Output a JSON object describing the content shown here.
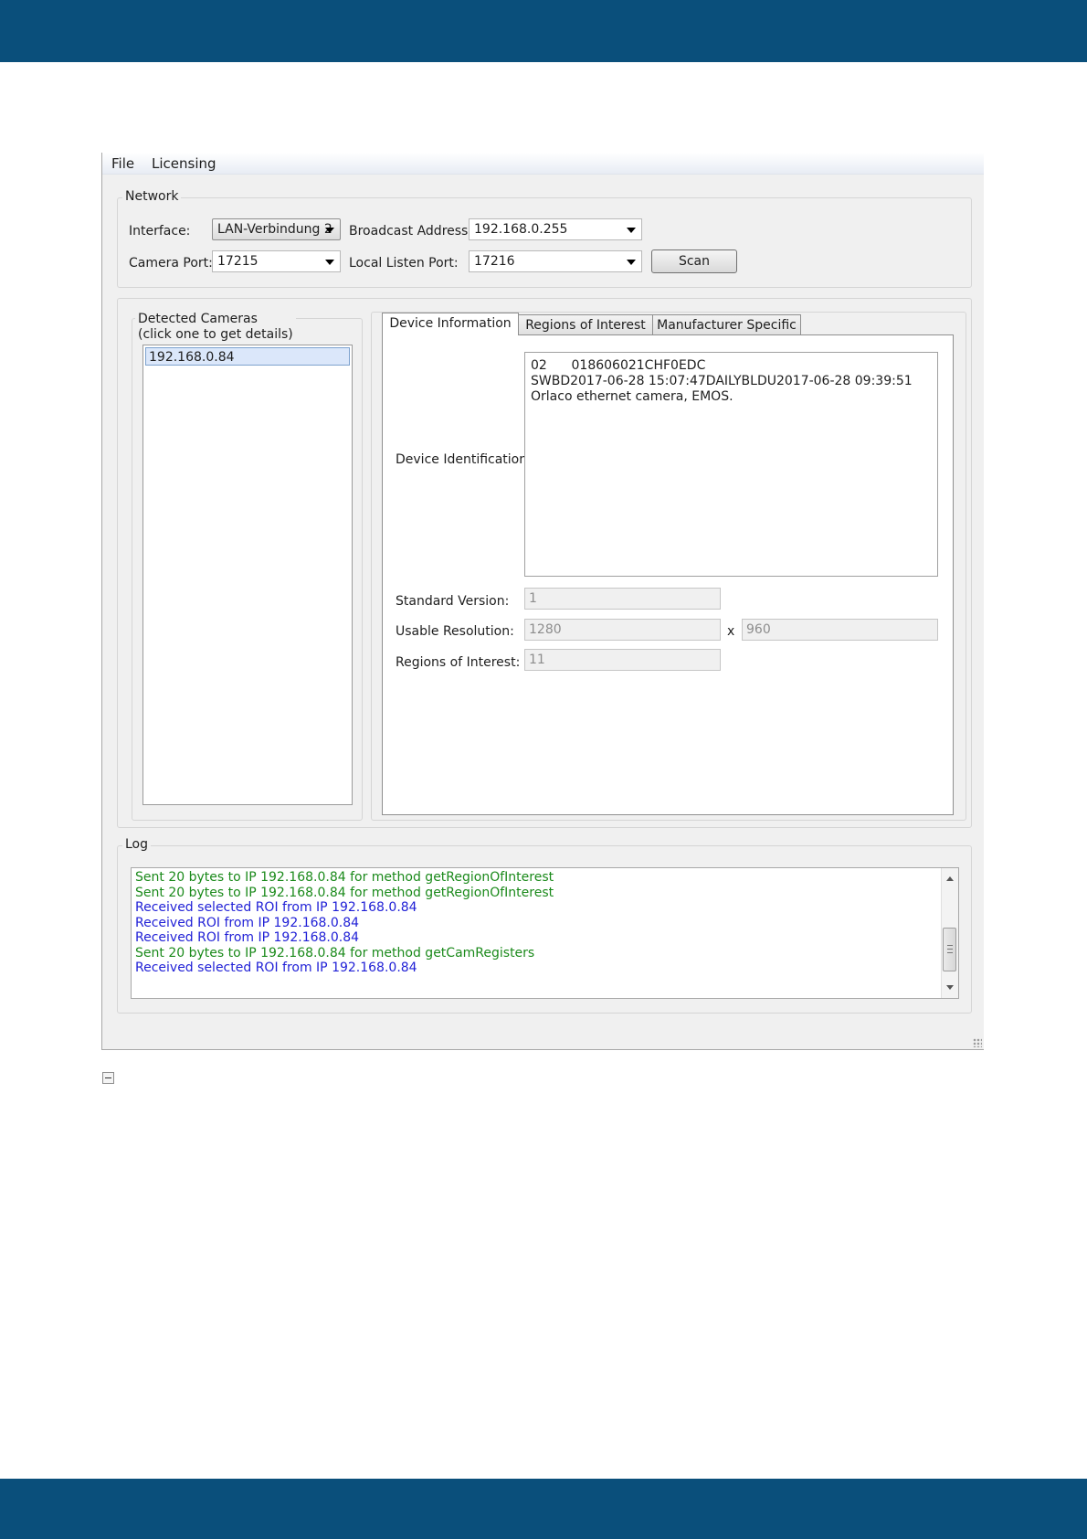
{
  "menu": {
    "items": [
      "File",
      "Licensing"
    ]
  },
  "network": {
    "group_title": "Network",
    "interface_label": "Interface:",
    "interface_value": "LAN-Verbindung 2",
    "broadcast_label": "Broadcast Address:",
    "broadcast_value": "192.168.0.255",
    "camera_port_label": "Camera Port:",
    "camera_port_value": "17215",
    "listen_port_label": "Local Listen Port:",
    "listen_port_value": "17216",
    "scan_label": "Scan"
  },
  "cameras": {
    "title_line1": "Detected Cameras",
    "title_line2": "(click one to get details)",
    "items": [
      "192.168.0.84"
    ]
  },
  "tabs": [
    "Device Information",
    "Regions of Interest",
    "Manufacturer Specific"
  ],
  "device_info": {
    "identification_label": "Device Identification:",
    "identification_text": "02      018606021CHF0EDC\nSWBD2017-06-28 15:07:47DAILYBLDU2017-06-28 09:39:51 Orlaco ethernet camera, EMOS.",
    "standard_version_label": "Standard Version:",
    "standard_version_value": "1",
    "usable_resolution_label": "Usable Resolution:",
    "resolution_width": "1280",
    "resolution_x": "x",
    "resolution_height": "960",
    "roi_label": "Regions of Interest:",
    "roi_value": "11"
  },
  "log": {
    "group_title": "Log",
    "lines": [
      {
        "text": "Sent 20 bytes to IP 192.168.0.84 for method getRegionOfInterest",
        "color": "#1b8a1b"
      },
      {
        "text": "Sent 20 bytes to IP 192.168.0.84 for method getRegionOfInterest",
        "color": "#1b8a1b"
      },
      {
        "text": "Received selected ROI from IP 192.168.0.84",
        "color": "#1f1fd6"
      },
      {
        "text": "Received ROI from IP 192.168.0.84",
        "color": "#1f1fd6"
      },
      {
        "text": "Received ROI from IP 192.168.0.84",
        "color": "#1f1fd6"
      },
      {
        "text": "Sent 20 bytes to IP 192.168.0.84 for method getCamRegisters",
        "color": "#1b8a1b"
      },
      {
        "text": "Received selected ROI from IP 192.168.0.84",
        "color": "#1f1fd6"
      }
    ]
  },
  "colors": {
    "band": "#0a4f7b",
    "window_bg": "#f0f0f0"
  }
}
